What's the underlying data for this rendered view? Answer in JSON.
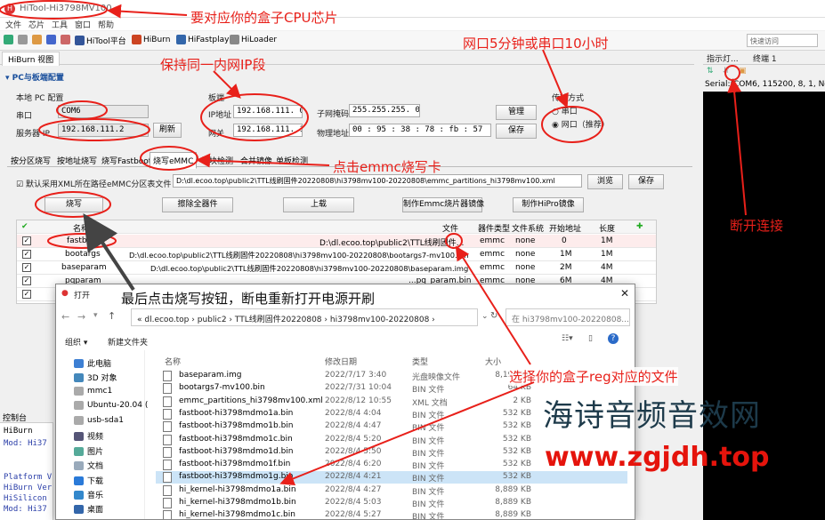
{
  "app": {
    "title": "HiTool-Hi3798MV100"
  },
  "menu": [
    "文件",
    "芯片",
    "工具",
    "窗口",
    "帮助"
  ],
  "toolbar": {
    "platform": "HiTool平台",
    "burn": "HiBurn",
    "fastplay": "HiFastplay",
    "loader": "HiLoader",
    "quick_access": "快速访问"
  },
  "view_tab": "HiBurn 视图",
  "pc_config": {
    "section": "PC与板端配置",
    "local_pc": "本地 PC 配置",
    "serial_label": "串口",
    "serial_value": "COM6",
    "server_ip_label": "服务器 IP",
    "server_ip_value": "192.168.111.2",
    "refresh": "刷新",
    "board_label": "板端",
    "ip_label": "IP地址",
    "ip_value": "192.168.111. 0",
    "gateway_label": "网关",
    "gateway_value": "192.168.111. 1",
    "mask_label": "子网掩码",
    "mask_value": "255.255.255. 0",
    "mac_label": "物理地址",
    "mac_value": "00 : 95 : 38 : 78 : fb : 57",
    "manage": "管理",
    "save": "保存",
    "transfer_label": "传输方式",
    "serial_opt": "串口",
    "net_opt": "网口（推荐）"
  },
  "tabs": [
    "按分区烧写",
    "按地址烧写",
    "烧写Fastboot",
    "烧写eMMC",
    "坏块检测",
    "合并镜像",
    "单板检测"
  ],
  "emmc": {
    "use_xml": "默认采用XML所在路径",
    "table_label": "eMMC分区表文件",
    "xml_path": "D:\\dl.ecoo.top\\public2\\TTL线刷固件20220808\\hi3798mv100-20220808\\emmc_partitions_hi3798mv100.xml",
    "browse": "浏览",
    "save": "保存",
    "burn": "烧写",
    "erase_all": "擦除全器件",
    "upload": "上载",
    "make_emmc_image": "制作Emmc烧片器镜像",
    "make_hipro_image": "制作HiPro镜像"
  },
  "table": {
    "headers": [
      "名称",
      "文件",
      "器件类型",
      "文件系统",
      "开始地址",
      "长度"
    ],
    "rows": [
      {
        "name": "fastboot",
        "file": "D:\\dl.ecoo.top\\public2\\TTL线刷固件...",
        "type": "emmc",
        "fs": "none",
        "start": "0",
        "len": "1M"
      },
      {
        "name": "bootargs",
        "file": "D:\\dl.ecoo.top\\public2\\TTL线刷固件20220808\\hi3798mv100-20220808\\bootargs7-mv100.bin",
        "type": "emmc",
        "fs": "none",
        "start": "1M",
        "len": "1M"
      },
      {
        "name": "baseparam",
        "file": "D:\\dl.ecoo.top\\public2\\TTL线刷固件20220808\\hi3798mv100-20220808\\baseparam.img",
        "type": "emmc",
        "fs": "none",
        "start": "2M",
        "len": "4M"
      },
      {
        "name": "pqparam",
        "file": "...pq_param.bin",
        "type": "emmc",
        "fs": "none",
        "start": "6M",
        "len": "4M"
      }
    ]
  },
  "right_panel": {
    "tab1": "指示灯...",
    "tab2": "终端 1",
    "serial_info": "Serial:(COM6, 115200, 8, 1, None"
  },
  "console": {
    "title": "控制台",
    "lines": [
      "HiBurn",
      "Mod: Hi37",
      "Platform V",
      "HiBurn Ver",
      "HiSilicon",
      "Mod: Hi37"
    ]
  },
  "dialog": {
    "title": "打开",
    "breadcrumb": [
      "dl.ecoo.top",
      "public2",
      "TTL线刷固件20220808",
      "hi3798mv100-20220808"
    ],
    "search": "在 hi3798mv100-20220808...",
    "organize": "组织",
    "new_folder": "新建文件夹",
    "nav": [
      "此电脑",
      "3D 对象",
      "mmc1",
      "Ubuntu-20.04 (",
      "usb-sda1",
      "视频",
      "图片",
      "文档",
      "下载",
      "音乐",
      "桌面"
    ],
    "columns": [
      "名称",
      "修改日期",
      "类型",
      "大小"
    ],
    "files": [
      {
        "name": "baseparam.img",
        "date": "2022/7/17 3:40",
        "type": "光盘映像文件",
        "size": "8,192 KB"
      },
      {
        "name": "bootargs7-mv100.bin",
        "date": "2022/7/31 10:04",
        "type": "BIN 文件",
        "size": "64 KB"
      },
      {
        "name": "emmc_partitions_hi3798mv100.xml",
        "date": "2022/8/12 10:55",
        "type": "XML 文档",
        "size": "2 KB"
      },
      {
        "name": "fastboot-hi3798mdmo1a.bin",
        "date": "2022/8/4 4:04",
        "type": "BIN 文件",
        "size": "532 KB"
      },
      {
        "name": "fastboot-hi3798mdmo1b.bin",
        "date": "2022/8/4 4:47",
        "type": "BIN 文件",
        "size": "532 KB"
      },
      {
        "name": "fastboot-hi3798mdmo1c.bin",
        "date": "2022/8/4 5:20",
        "type": "BIN 文件",
        "size": "532 KB"
      },
      {
        "name": "fastboot-hi3798mdmo1d.bin",
        "date": "2022/8/4 5:50",
        "type": "BIN 文件",
        "size": "532 KB"
      },
      {
        "name": "fastboot-hi3798mdmo1f.bin",
        "date": "2022/8/4 6:20",
        "type": "BIN 文件",
        "size": "532 KB"
      },
      {
        "name": "fastboot-hi3798mdmo1g.bin",
        "date": "2022/8/4 4:21",
        "type": "BIN 文件",
        "size": "532 KB"
      },
      {
        "name": "hi_kernel-hi3798mdmo1a.bin",
        "date": "2022/8/4 4:27",
        "type": "BIN 文件",
        "size": "8,889 KB"
      },
      {
        "name": "hi_kernel-hi3798mdmo1b.bin",
        "date": "2022/8/4 5:03",
        "type": "BIN 文件",
        "size": "8,889 KB"
      },
      {
        "name": "hi_kernel-hi3798mdmo1c.bin",
        "date": "2022/8/4 5:27",
        "type": "BIN 文件",
        "size": "8,889 KB"
      }
    ]
  },
  "annotations": {
    "cpu": "要对应你的盒子CPU芯片",
    "same_ip": "保持同一内网IP段",
    "speed": "网口5分钟或串口10小时",
    "click_emmc": "点击emmc烧写卡",
    "disconnect": "断开连接",
    "final": "最后点击烧写按钮，断电重新打开电源开刷",
    "select_reg": "选择你的盒子reg对应的文件"
  },
  "watermark": {
    "cn": "海诗音频音效网",
    "url": "www.zgjdh.top"
  },
  "colors": {
    "annotation": "#e8201a",
    "selection": "#cce4f7",
    "terminal": "#000000"
  }
}
